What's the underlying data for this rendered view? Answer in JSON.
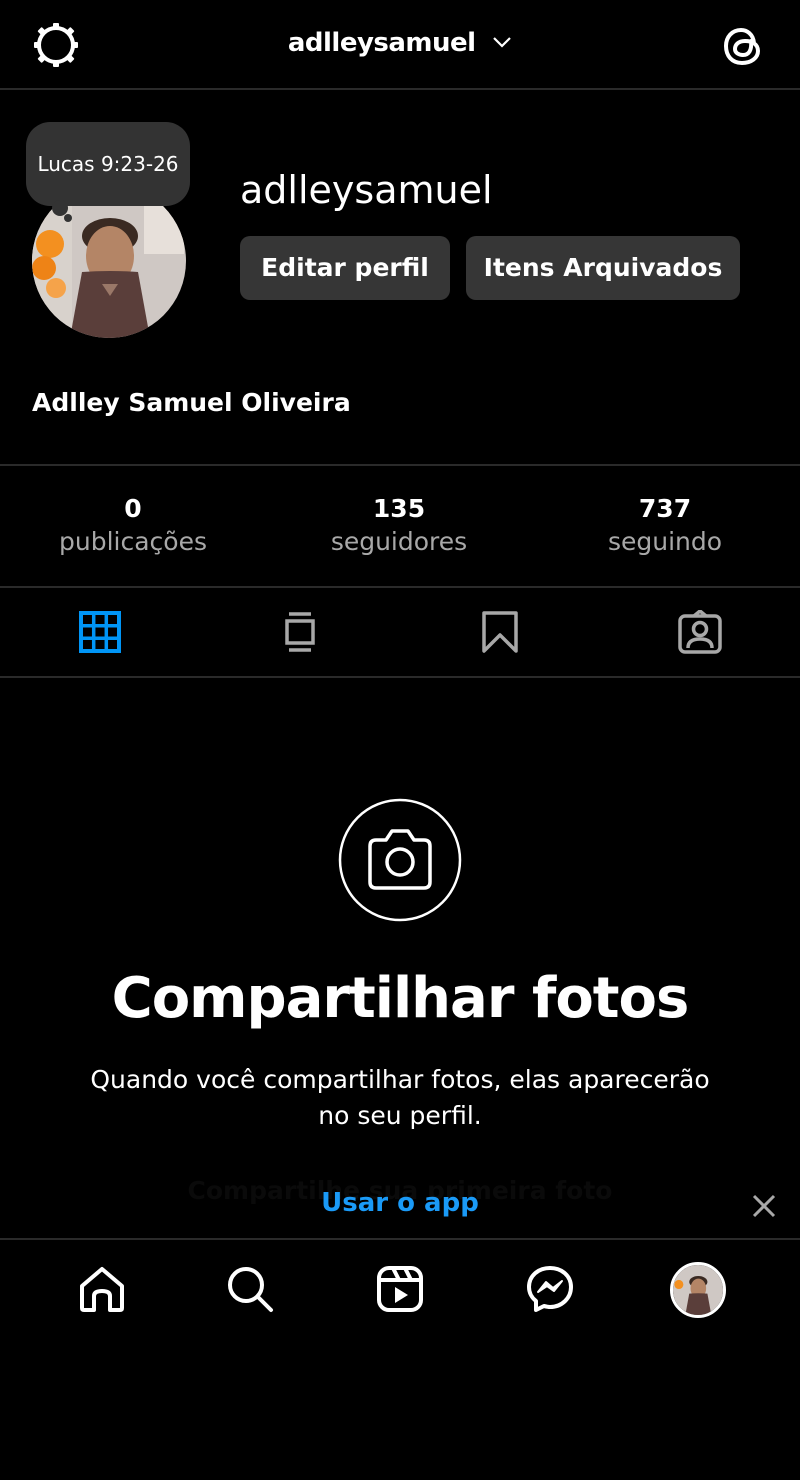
{
  "header": {
    "username": "adlleysamuel"
  },
  "profile": {
    "note": "Lucas 9:23-26",
    "username": "adlleysamuel",
    "edit_button": "Editar perfil",
    "archive_button": "Itens Arquivados",
    "full_name": "Adlley Samuel Oliveira"
  },
  "stats": [
    {
      "value": "0",
      "label": "publicações"
    },
    {
      "value": "135",
      "label": "seguidores"
    },
    {
      "value": "737",
      "label": "seguindo"
    }
  ],
  "tabs": [
    {
      "icon": "grid-icon",
      "active": true
    },
    {
      "icon": "feed-icon",
      "active": false
    },
    {
      "icon": "bookmark-icon",
      "active": false
    },
    {
      "icon": "tagged-icon",
      "active": false
    }
  ],
  "empty_state": {
    "title": "Compartilhar fotos",
    "description": "Quando você compartilhar fotos, elas aparecerão no seu perfil.",
    "link": "Compartilhe sua primeira foto"
  },
  "banner": {
    "use_app": "Usar o app"
  },
  "nav": [
    {
      "icon": "home-icon"
    },
    {
      "icon": "search-icon"
    },
    {
      "icon": "reels-icon"
    },
    {
      "icon": "messenger-icon"
    },
    {
      "icon": "profile-avatar"
    }
  ],
  "colors": {
    "accent": "#0095f6",
    "link": "#1a9af7",
    "background": "#000000",
    "button": "#363636",
    "muted": "#a8a8a8"
  }
}
